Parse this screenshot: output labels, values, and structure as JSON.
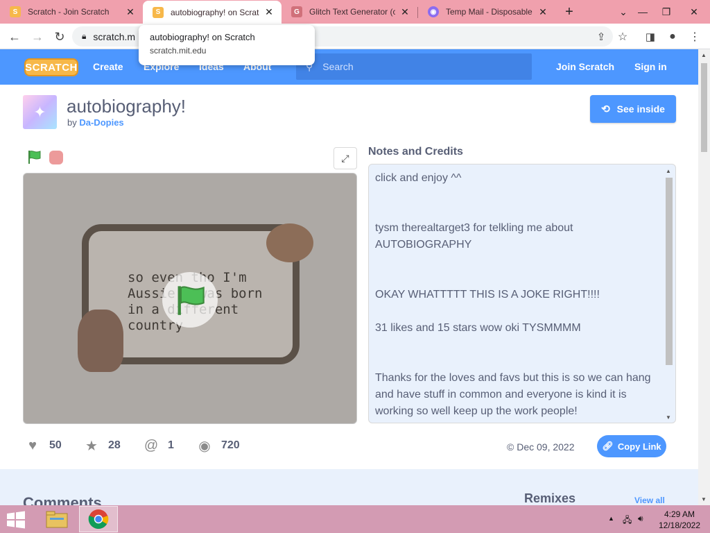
{
  "browser": {
    "tabs": [
      {
        "title": "Scratch - Join Scratch",
        "favicon": "scratch-icon",
        "color": "#f7b84a"
      },
      {
        "title": "autobiography! on Scratc",
        "favicon": "scratch-icon",
        "color": "#f7b84a"
      },
      {
        "title": "Glitch Text Generator (co",
        "favicon": "glitch-icon",
        "color": "#d0707a"
      },
      {
        "title": "Temp Mail - Disposable T",
        "favicon": "tempmail-icon",
        "color": "#8b6cf0"
      }
    ],
    "url": "scratch.m",
    "tooltip": {
      "title": "autobiography! on Scratch",
      "domain": "scratch.mit.edu"
    }
  },
  "scratch_nav": {
    "logo": "SCRATCH",
    "links": [
      "Create",
      "Explore",
      "Ideas",
      "About"
    ],
    "search_placeholder": "Search",
    "join": "Join Scratch",
    "signin": "Sign in"
  },
  "project": {
    "title": "autobiography!",
    "by_label": "by",
    "author": "Da-Dopies",
    "see_inside": "See inside",
    "stage_text": "so even tho I'm\nAussie I was born\nin a different\ncountry",
    "notes_heading": "Notes and Credits",
    "notes": "click and enjoy ^^\n\n\ntysm therealtarget3 for telkling me about AUTOBIOGRAPHY\n\n\nOKAY WHATTTTT THIS IS A JOKE RIGHT!!!!\n\n31 likes and 15 stars wow oki TYSMMMM\n\n\nThanks for the loves and favs but this is so we can hang and have stuff in common and everyone is kind it is working so well keep up the work people!",
    "stats": {
      "loves": "50",
      "favorites": "28",
      "remixes": "1",
      "views": "720"
    },
    "shared_date": "© Dec 09, 2022",
    "copy_link": "Copy Link"
  },
  "lower": {
    "comments": "Comments",
    "remixes": "Remixes",
    "view_all": "View all"
  },
  "taskbar": {
    "time": "4:29 AM",
    "date": "12/18/2022"
  },
  "colors": {
    "scratch_blue": "#4d97ff",
    "tab_strip": "#f0a0ad",
    "taskbar": "#d39bb3"
  }
}
